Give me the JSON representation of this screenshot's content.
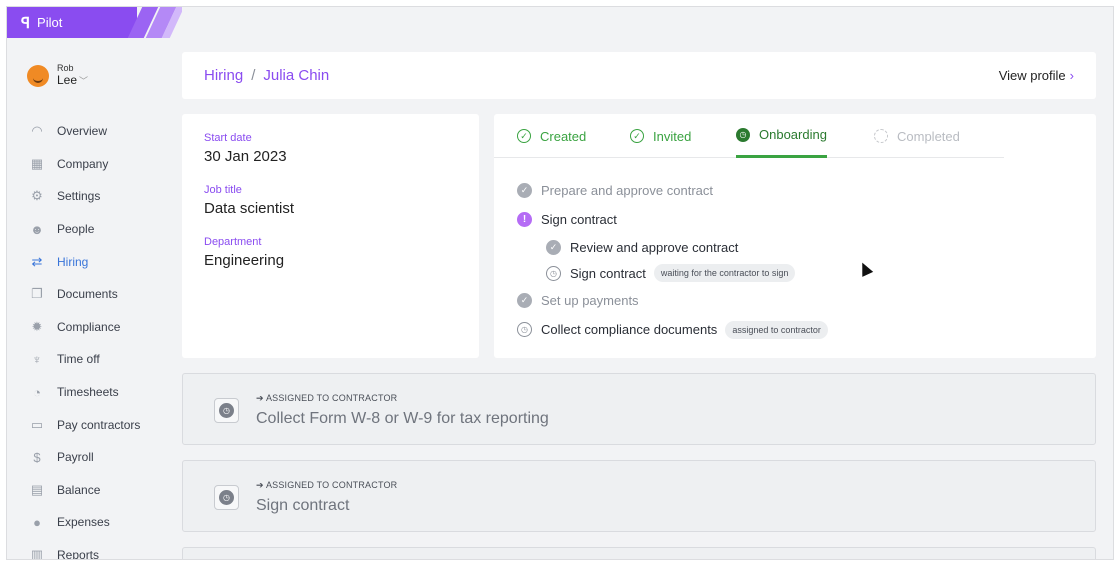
{
  "app": {
    "name": "Pilot"
  },
  "user": {
    "first": "Rob",
    "last": "Lee"
  },
  "nav": [
    {
      "label": "Overview",
      "icon": "gauge-icon",
      "glyph": "◠"
    },
    {
      "label": "Company",
      "icon": "building-icon",
      "glyph": "▦"
    },
    {
      "label": "Settings",
      "icon": "gear-icon",
      "glyph": "⚙"
    },
    {
      "label": "People",
      "icon": "smiley-icon",
      "glyph": "☻"
    },
    {
      "label": "Hiring",
      "icon": "handshake-icon",
      "glyph": "⇄",
      "active": true
    },
    {
      "label": "Documents",
      "icon": "documents-icon",
      "glyph": "❐"
    },
    {
      "label": "Compliance",
      "icon": "badge-icon",
      "glyph": "✹"
    },
    {
      "label": "Time off",
      "icon": "palm-tree-icon",
      "glyph": "♆"
    },
    {
      "label": "Timesheets",
      "icon": "clock-icon",
      "glyph": "◔"
    },
    {
      "label": "Pay contractors",
      "icon": "cash-icon",
      "glyph": "▭"
    },
    {
      "label": "Payroll",
      "icon": "dollar-icon",
      "glyph": "$"
    },
    {
      "label": "Balance",
      "icon": "coins-icon",
      "glyph": "▤"
    },
    {
      "label": "Expenses",
      "icon": "piggy-bank-icon",
      "glyph": "●"
    },
    {
      "label": "Reports",
      "icon": "report-icon",
      "glyph": "▥"
    }
  ],
  "breadcrumb": {
    "parent": "Hiring",
    "separator": "/",
    "current": "Julia Chin"
  },
  "view_profile": "View profile",
  "details": [
    {
      "label": "Start date",
      "value": "30 Jan 2023"
    },
    {
      "label": "Job title",
      "value": "Data scientist"
    },
    {
      "label": "Department",
      "value": "Engineering"
    }
  ],
  "tabs": [
    {
      "label": "Created",
      "state": "done"
    },
    {
      "label": "Invited",
      "state": "done"
    },
    {
      "label": "Onboarding",
      "state": "active"
    },
    {
      "label": "Completed",
      "state": "todo"
    }
  ],
  "steps": [
    {
      "label": "Prepare and approve contract",
      "status": "check",
      "muted": true
    },
    {
      "label": "Sign contract",
      "status": "warn"
    },
    {
      "label": "Review and approve contract",
      "status": "check",
      "sub": true
    },
    {
      "label": "Sign contract",
      "status": "clock",
      "sub": true,
      "badge": "waiting for the contractor to sign"
    },
    {
      "label": "Set up payments",
      "status": "check",
      "muted": true
    },
    {
      "label": "Collect compliance documents",
      "status": "clock",
      "badge": "assigned to contractor"
    }
  ],
  "tasks": [
    {
      "assigned": "ASSIGNED TO CONTRACTOR",
      "title": "Collect Form W-8 or W-9 for tax reporting"
    },
    {
      "assigned": "ASSIGNED TO CONTRACTOR",
      "title": "Sign contract"
    }
  ],
  "colors": {
    "brand": "#8a4cf0",
    "active_nav": "#3874d9",
    "success": "#3aa341"
  }
}
